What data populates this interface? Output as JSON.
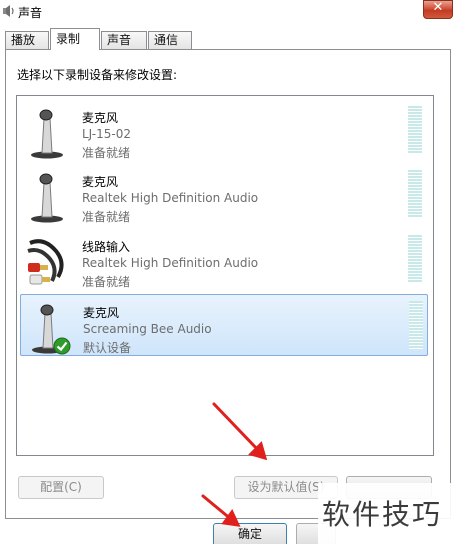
{
  "window": {
    "title": "声音",
    "close_glyph": "✕"
  },
  "tabs": [
    {
      "label": "播放",
      "active": false
    },
    {
      "label": "录制",
      "active": true
    },
    {
      "label": "声音",
      "active": false
    },
    {
      "label": "通信",
      "active": false
    }
  ],
  "instruction": "选择以下录制设备来修改设置:",
  "devices": [
    {
      "name": "麦克风",
      "description": "LJ-15-02",
      "status": "准备就绪",
      "icon": "microphone-icon",
      "selected": false
    },
    {
      "name": "麦克风",
      "description": "Realtek High Definition Audio",
      "status": "准备就绪",
      "icon": "microphone-icon",
      "selected": false
    },
    {
      "name": "线路输入",
      "description": "Realtek High Definition Audio",
      "status": "准备就绪",
      "icon": "line-in-cable-icon",
      "selected": false
    },
    {
      "name": "麦克风",
      "description": "Screaming Bee Audio",
      "status": "默认设备",
      "icon": "microphone-icon",
      "selected": true,
      "badge": "default-check-icon"
    }
  ],
  "buttons": {
    "configure": "配置(C)",
    "set_default": "设为默认值(S)",
    "ok": "确定"
  },
  "watermark": "软件技巧",
  "colors": {
    "annotation_arrow": "#e0201c",
    "selection": "#cfe5fb",
    "level_meter": "#c7e9ea"
  }
}
